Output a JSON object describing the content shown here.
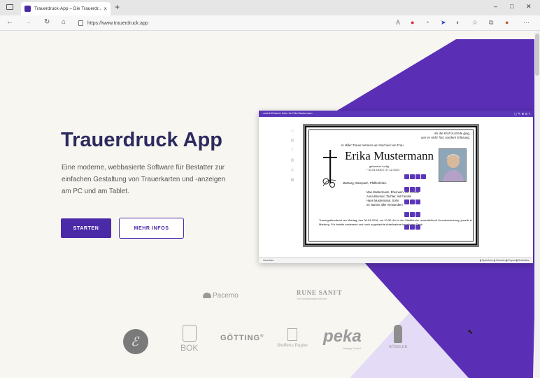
{
  "browser": {
    "tab_title": "Trauerdruck-App – Die Trauerdr...",
    "tab_close": "×",
    "new_tab": "+",
    "url": "https://www.trauerdruck.app",
    "minimize": "–",
    "maximize": "□",
    "close": "✕",
    "menu": "···"
  },
  "hero": {
    "title": "Trauerdruck App",
    "description": "Eine moderne, webbasierte Software für Bestatter zur einfachen Gestaltung von Trauerkarten und -anzeigen am PC und am Tablet.",
    "start_label": "STARTEN",
    "more_label": "MEHR INFOS"
  },
  "mock_app": {
    "header": "‹ zurück   Einfache Karte 1a Erika Mustermann",
    "bottom_left": "Vorschau",
    "bottom_right": "▮ Speichern  ▮ Drucken  ▮ Export  ▮ Schließen",
    "card": {
      "quote_line1": "Als die Kraft zu Ende ging,",
      "quote_line2": "war es nicht Tod, sondern Erlösung.",
      "intro": "In stiller Trauer nehmen wir Abschied von Frau",
      "name": "Erika Mustermann",
      "born": "geborene Lodig",
      "dates": "* 01.01.1930  † 27.12.2021",
      "places": "Marburg, Weinpach, Pfaffenhofen",
      "family": [
        "Max Mustermann, Ehemann, mit Familie",
        "Anna Brunner, Tochter, mit Familie",
        "Hans Mustermann, Sohn",
        "Im Namen aller Verwandten"
      ],
      "ceremony": "Trauergottesdienst am Montag, den 06.04.2016, um 10:30 Uhr in der Stadtkirche, anschließend Urnenbeisetzung, jeweils in Marburg. Für bereits erwiesene und noch zugedachte Anteilnahme herzlichen Dank."
    }
  },
  "partners": {
    "pacemo": "Pacemo",
    "rune_sanft": "RUNE SANFT",
    "rune_sanft_sub": "Die Bestattungssoftware",
    "bok": "BOK",
    "gotting": "GÖTTING",
    "steffens": "Steffens Papier",
    "peka": "peka",
    "peka_sub": "Verlags GmbH",
    "rossler": "RÖSSLER"
  },
  "colors": {
    "brand": "#4b2aa8",
    "title": "#2c2a5e",
    "stripe_light": "#e4dcf6"
  }
}
